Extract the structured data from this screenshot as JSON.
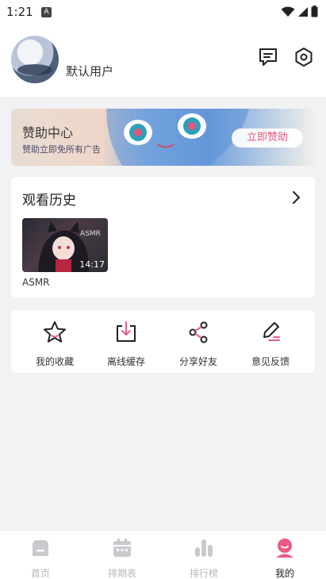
{
  "status_bar": {
    "time": "1:21",
    "app_icon": "A"
  },
  "profile": {
    "user_name": "默认用户"
  },
  "banner": {
    "title": "赞助中心",
    "subtitle": "赞助立即免所有广告",
    "button": "立即赞助"
  },
  "history": {
    "title": "观看历史",
    "items": [
      {
        "label": "ASMR",
        "duration": "14:17",
        "thumb_text": "ASMR"
      }
    ]
  },
  "actions": [
    {
      "label": "我的收藏",
      "icon": "star-icon"
    },
    {
      "label": "离线缓存",
      "icon": "download-icon"
    },
    {
      "label": "分享好友",
      "icon": "share-icon"
    },
    {
      "label": "意见反馈",
      "icon": "edit-icon"
    }
  ],
  "nav": [
    {
      "label": "首页",
      "icon": "home-icon"
    },
    {
      "label": "排期表",
      "icon": "calendar-icon"
    },
    {
      "label": "排行榜",
      "icon": "ranking-icon"
    },
    {
      "label": "我的",
      "icon": "user-icon",
      "active": true
    }
  ],
  "colors": {
    "accent": "#ea5a83",
    "inactive": "#c9c9ce"
  }
}
